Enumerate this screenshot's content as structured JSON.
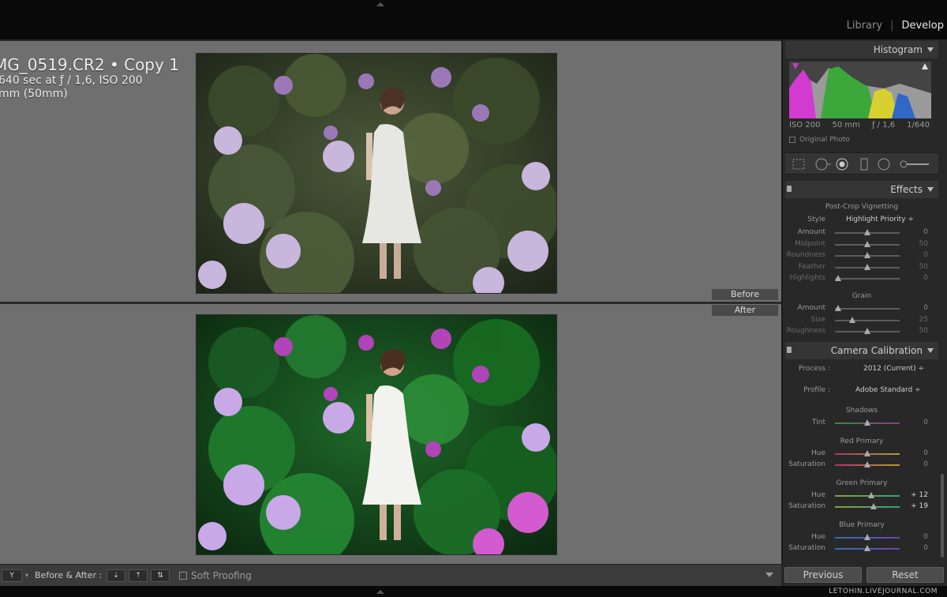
{
  "modules": {
    "library": "Library",
    "develop": "Develop"
  },
  "photo_info": {
    "filename": "MG_0519.CR2  •  Copy 1",
    "exposure": "640 sec at ƒ / 1,6, ISO 200",
    "lens": "mm (50mm)"
  },
  "labels": {
    "before": "Before",
    "after": "After"
  },
  "toolbar": {
    "before_after": "Before & After :",
    "soft_proofing": "Soft Proofing"
  },
  "histogram": {
    "title": "Histogram",
    "iso": "ISO 200",
    "focal": "50 mm",
    "aperture": "ƒ / 1,6",
    "shutter": "1/640",
    "original_photo": "Original Photo"
  },
  "effects": {
    "title": "Effects",
    "vignette_title": "Post-Crop Vignetting",
    "style_label": "Style",
    "style_value": "Highlight Priority ÷",
    "vignette": [
      {
        "label": "Amount",
        "value": "0",
        "pos": 0.5,
        "dim": false
      },
      {
        "label": "Midpoint",
        "value": "50",
        "pos": 0.5,
        "dim": true
      },
      {
        "label": "Roundness",
        "value": "0",
        "pos": 0.5,
        "dim": true
      },
      {
        "label": "Feather",
        "value": "50",
        "pos": 0.5,
        "dim": true
      },
      {
        "label": "Highlights",
        "value": "0",
        "pos": 0.05,
        "dim": true
      }
    ],
    "grain_title": "Grain",
    "grain": [
      {
        "label": "Amount",
        "value": "0",
        "pos": 0.05,
        "dim": false
      },
      {
        "label": "Size",
        "value": "25",
        "pos": 0.27,
        "dim": true
      },
      {
        "label": "Roughness",
        "value": "50",
        "pos": 0.5,
        "dim": true
      }
    ]
  },
  "calibration": {
    "title": "Camera Calibration",
    "process_label": "Process :",
    "process_value": "2012 (Current) ÷",
    "profile_label": "Profile :",
    "profile_value": "Adobe Standard ÷",
    "shadows_title": "Shadows",
    "shadows": [
      {
        "label": "Tint",
        "value": "0",
        "pos": 0.5
      }
    ],
    "red_title": "Red Primary",
    "red": [
      {
        "label": "Hue",
        "value": "0",
        "pos": 0.5
      },
      {
        "label": "Saturation",
        "value": "0",
        "pos": 0.5
      }
    ],
    "green_title": "Green Primary",
    "green": [
      {
        "label": "Hue",
        "value": "+ 12",
        "pos": 0.56
      },
      {
        "label": "Saturation",
        "value": "+ 19",
        "pos": 0.6
      }
    ],
    "blue_title": "Blue Primary",
    "blue": [
      {
        "label": "Hue",
        "value": "0",
        "pos": 0.5
      },
      {
        "label": "Saturation",
        "value": "0",
        "pos": 0.5
      }
    ]
  },
  "buttons": {
    "previous": "Previous",
    "reset": "Reset"
  },
  "watermark": "LETOHIN.LIVEJOURNAL.COM"
}
